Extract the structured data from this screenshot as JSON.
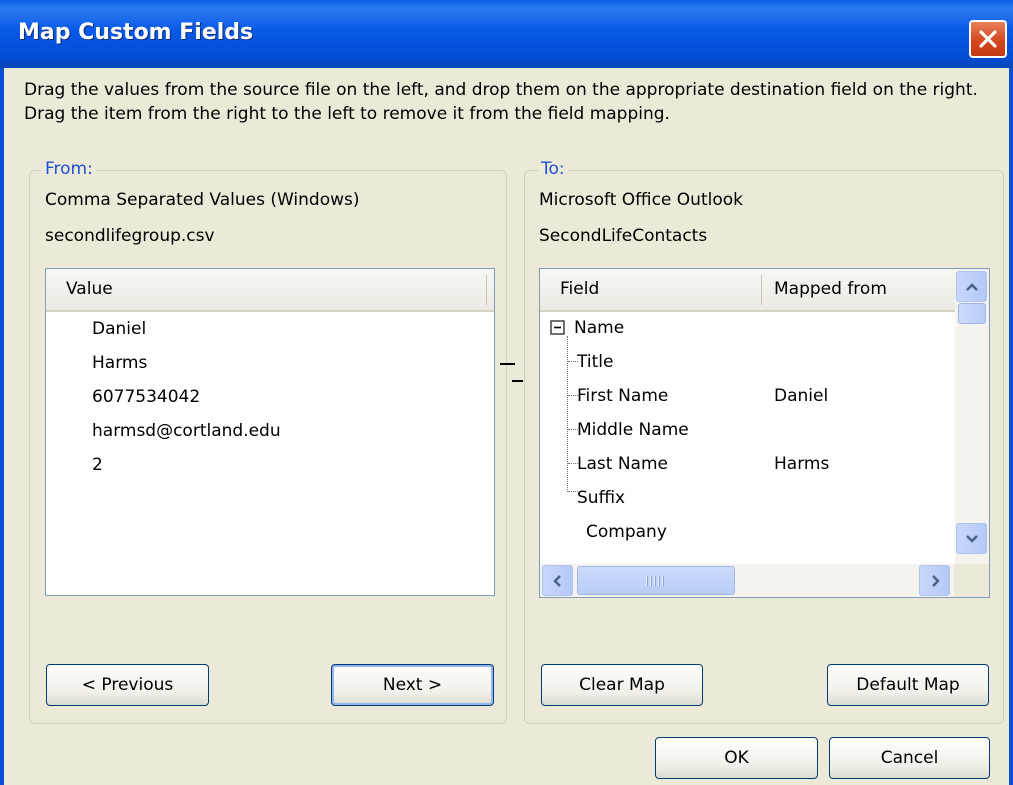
{
  "window": {
    "title": "Map Custom Fields",
    "close_icon": "close-icon"
  },
  "instructions": "Drag the values from the source file on the left, and drop them on the appropriate destination field on the right.  Drag the item from the right to the left to remove it from the field mapping.",
  "from": {
    "legend": "From:",
    "source_type": "Comma Separated Values (Windows)",
    "source_file": "secondlifegroup.csv",
    "column_header": "Value",
    "values": [
      "Daniel",
      "Harms",
      "6077534042",
      "harmsd@cortland.edu",
      "2"
    ],
    "previous_label": "< Previous",
    "next_label": "Next >"
  },
  "to": {
    "legend": "To:",
    "dest_type": "Microsoft Office Outlook",
    "dest_folder": "SecondLifeContacts",
    "headers": {
      "field": "Field",
      "mapped": "Mapped from"
    },
    "group_name": "Name",
    "rows": [
      {
        "field": "Title",
        "mapped": ""
      },
      {
        "field": "First Name",
        "mapped": "Daniel"
      },
      {
        "field": "Middle Name",
        "mapped": ""
      },
      {
        "field": "Last Name",
        "mapped": "Harms"
      },
      {
        "field": "Suffix",
        "mapped": ""
      }
    ],
    "after_group": "Company",
    "clear_label": "Clear Map",
    "default_label": "Default Map"
  },
  "footer": {
    "ok_label": "OK",
    "cancel_label": "Cancel"
  },
  "colors": {
    "title_bar": "#0858e6",
    "legend_text": "#1e50d2",
    "dialog_bg": "#ece9d8"
  }
}
